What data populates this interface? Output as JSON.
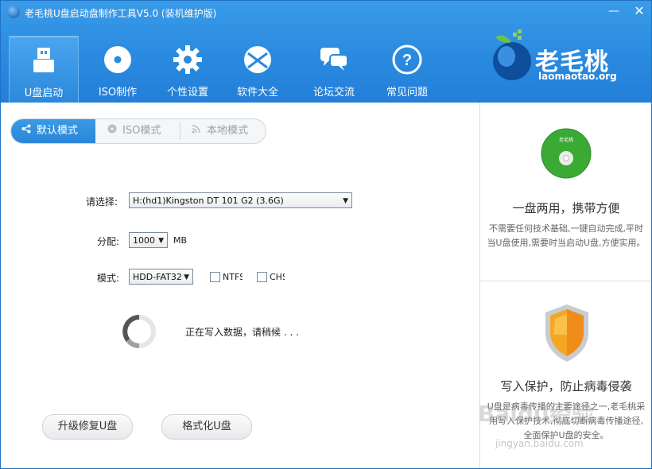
{
  "window": {
    "title": "老毛桃U盘启动盘制作工具V5.0 (装机维护版)",
    "minimize_glyph": "—",
    "close_glyph": "✕"
  },
  "nav": {
    "items": [
      {
        "label": "U盘启动",
        "icon": "usb-drive-icon",
        "active": true
      },
      {
        "label": "ISO制作",
        "icon": "disc-icon"
      },
      {
        "label": "个性设置",
        "icon": "gear-icon"
      },
      {
        "label": "软件大全",
        "icon": "software-icon"
      },
      {
        "label": "论坛交流",
        "icon": "chat-icon"
      },
      {
        "label": "常见问题",
        "icon": "question-icon"
      }
    ]
  },
  "logo": {
    "name": "老毛桃",
    "url": "laomaotao.org"
  },
  "mode_tabs": [
    {
      "label": "默认模式",
      "icon": "share-icon",
      "active": true
    },
    {
      "label": "ISO模式",
      "icon": "disc-icon"
    },
    {
      "label": "本地模式",
      "icon": "rss-icon"
    }
  ],
  "form": {
    "device_label": "请选择:",
    "device_value": "H:(hd1)Kingston DT 101 G2 (3.6G)",
    "alloc_label": "分配:",
    "alloc_value": "1000",
    "alloc_unit": "MB",
    "mode_label": "模式:",
    "mode_value": "HDD-FAT32",
    "ntfs_label": "NTFS",
    "chs_label": "CHS"
  },
  "progress": {
    "text": "正在写入数据，请稍候 . . ."
  },
  "actions": {
    "repair": "升级修复U盘",
    "format": "格式化U盘"
  },
  "side": {
    "cd_label": "老毛桃",
    "feature1_title": "一盘两用，携带方便",
    "feature1_desc": "不需要任何技术基础,一键自动完成,平时当U盘使用,需要时当启动U盘,方便实用。",
    "feature2_title": "写入保护，防止病毒侵袭",
    "feature2_desc": "U盘是病毒传播的主要途径之一,老毛桃采用写入保护技术,彻底切断病毒传播途径,全面保护U盘的安全。"
  },
  "watermark": {
    "text": "Baidu经验",
    "url": "jingyan.baidu.com"
  },
  "colors": {
    "header": "#2a8ae0",
    "accent": "#2a86d8",
    "shield": "#f5a623",
    "cd": "#3aaa35"
  }
}
